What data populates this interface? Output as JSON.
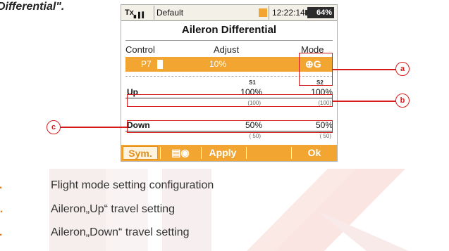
{
  "caption": "Differential\".",
  "status_bar": {
    "tx_label": "Tx",
    "model": "Default",
    "time": "12:22:14",
    "battery": "64%"
  },
  "screen_title": "Aileron Differential",
  "table_headers": {
    "control": "Control",
    "adjust": "Adjust",
    "mode": "Mode"
  },
  "selected_row": {
    "control": "P7",
    "adjust": "10%",
    "mode_symbol": "⊕G"
  },
  "switch_labels": {
    "s1": "S1",
    "s2": "S2"
  },
  "rows": [
    {
      "name": "Up",
      "s1": "100%",
      "s1_sub": "(100)",
      "s2": "100%",
      "s2_sub": "(100)"
    },
    {
      "name": "Down",
      "s1": "50%",
      "s1_sub": "( 50)",
      "s2": "50%",
      "s2_sub": "( 50)"
    }
  ],
  "buttons": {
    "sym": "Sym.",
    "apply": "Apply",
    "ok": "Ok"
  },
  "callouts": {
    "a": "a",
    "b": "b",
    "c": "c"
  },
  "legend": [
    {
      "letter": "a.",
      "text": "Flight mode setting configuration"
    },
    {
      "letter": "b.",
      "text": "Aileron„Up“ travel setting"
    },
    {
      "letter": "c.",
      "text": "Aileron„Down“ travel setting"
    }
  ],
  "colors": {
    "accent": "#f2a531",
    "callout": "#d81b1b",
    "legend_letter": "#e57a1c"
  }
}
